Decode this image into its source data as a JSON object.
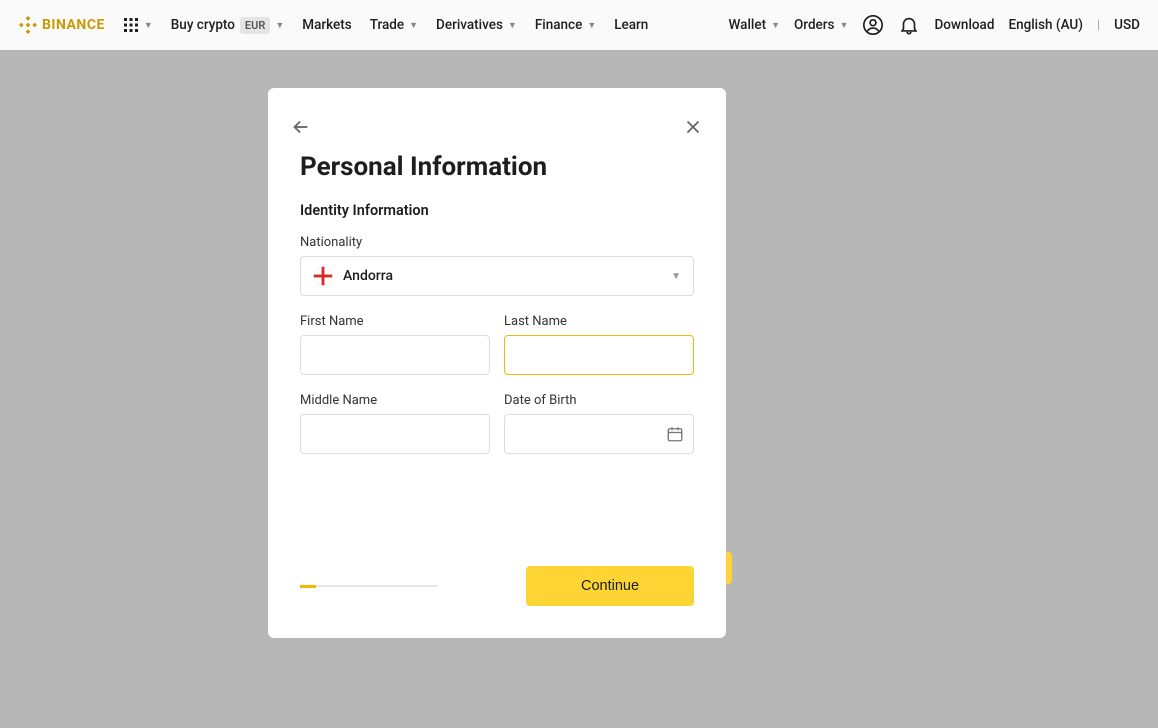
{
  "nav": {
    "logo_text": "BINANCE",
    "buy_crypto": "Buy crypto",
    "eur_badge": "EUR",
    "markets": "Markets",
    "trade": "Trade",
    "derivatives": "Derivatives",
    "finance": "Finance",
    "learn": "Learn",
    "wallet": "Wallet",
    "orders": "Orders",
    "download": "Download",
    "language": "English (AU)",
    "currency": "USD"
  },
  "modal": {
    "title": "Personal Information",
    "section": "Identity Information",
    "nationality_label": "Nationality",
    "nationality_value": "Andorra",
    "first_name_label": "First Name",
    "last_name_label": "Last Name",
    "middle_name_label": "Middle Name",
    "dob_label": "Date of Birth",
    "continue": "Continue"
  }
}
